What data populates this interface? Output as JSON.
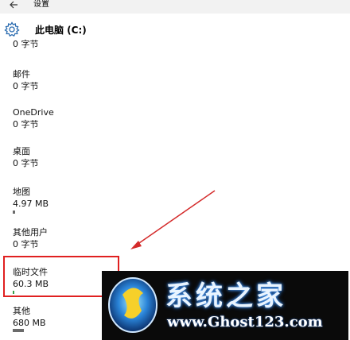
{
  "window": {
    "title": "设置"
  },
  "header": {
    "title": "此电脑 (C:)"
  },
  "items": [
    {
      "name": "",
      "size": "0 字节"
    },
    {
      "name": "邮件",
      "size": "0 字节"
    },
    {
      "name": "OneDrive",
      "size": "0 字节"
    },
    {
      "name": "桌面",
      "size": "0 字节"
    },
    {
      "name": "地图",
      "size": "4.97 MB"
    },
    {
      "name": "其他用户",
      "size": "0 字节"
    },
    {
      "name": "临时文件",
      "size": "60.3 MB"
    },
    {
      "name": "其他",
      "size": "680 MB"
    }
  ],
  "watermark": {
    "title": "系统之家",
    "url": "www.Ghost123.com"
  },
  "colors": {
    "highlight": "#e02020",
    "arrow": "#d42a2a",
    "accent": "#2b6cb0"
  },
  "icons": {
    "back": "back-arrow-icon",
    "settings": "gear-icon"
  }
}
